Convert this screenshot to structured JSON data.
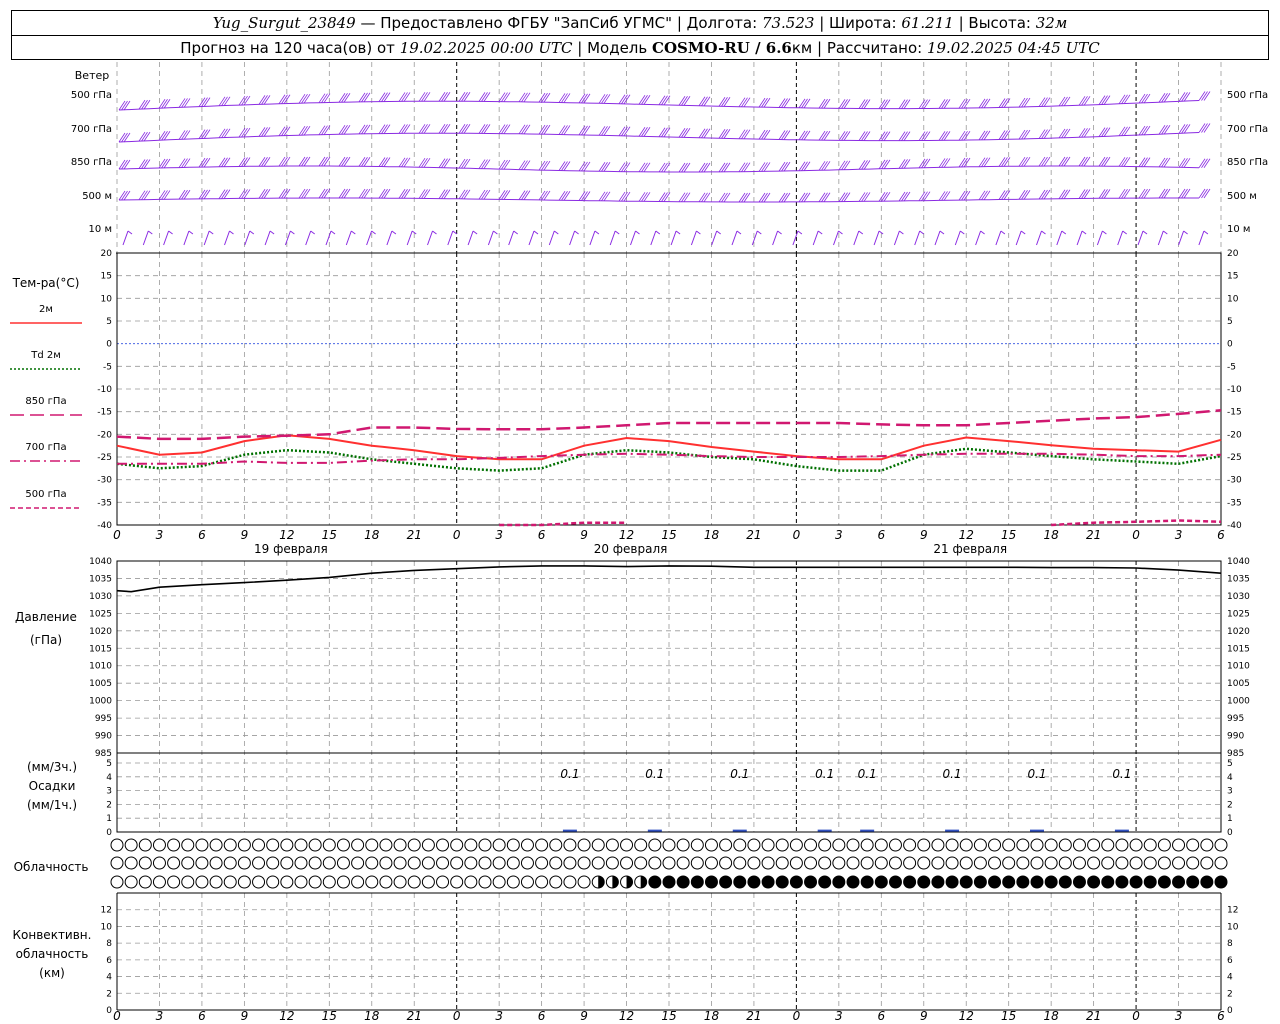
{
  "header": {
    "station": "Yug_Surgut_23849",
    "provider": "— Предоставлено ФГБУ \"ЗапСиб УГМС\"",
    "lon_label": "Долгота:",
    "lon": "73.523",
    "lat_label": "Широта:",
    "lat": "61.211",
    "alt_label": "Высота:",
    "alt": "32м",
    "forecast_label": "Прогноз на 120 часа(ов) от",
    "start": "19.02.2025 00:00 UTC",
    "model_label": "Модель",
    "model": "COSMO-RU / 6.6",
    "model_unit": "км",
    "calc_label": "Рассчитано:",
    "calc_time": "19.02.2025 04:45 UTC"
  },
  "wind_panel": {
    "title": "Ветер",
    "levels": [
      "500 гПа",
      "700 гПа",
      "850 гПа",
      "500 м",
      "10 м"
    ],
    "color": "#8a2be2"
  },
  "temp_panel": {
    "title": "Тем-ра(°C)",
    "legend": [
      {
        "label": "2м",
        "color": "#ff3030",
        "dash": "solid"
      },
      {
        "label": "Td 2м",
        "color": "#007000",
        "dash": "dot"
      },
      {
        "label": "850 гПа",
        "color": "#d01870",
        "dash": "longdash"
      },
      {
        "label": "700 гПа",
        "color": "#d01870",
        "dash": "dashdot"
      },
      {
        "label": "500 гПа",
        "color": "#d01870",
        "dash": "shortdash"
      }
    ],
    "yticks": [
      "20",
      "15",
      "10",
      "5",
      "0",
      "-5",
      "-10",
      "-15",
      "-20",
      "-25",
      "-30",
      "-35",
      "-40"
    ]
  },
  "time_axis": {
    "hour_labels": [
      "0",
      "3",
      "6",
      "9",
      "12",
      "15",
      "18",
      "21",
      "0",
      "3",
      "6",
      "9",
      "12",
      "15",
      "18",
      "21",
      "0",
      "3",
      "6",
      "9",
      "12",
      "15",
      "18",
      "21",
      "0",
      "3",
      "6"
    ],
    "day_labels": [
      "19 февраля",
      "20 февраля",
      "21 февраля"
    ]
  },
  "pressure_panel": {
    "title": "Давление",
    "unit": "(гПа)",
    "yticks": [
      "1040",
      "1035",
      "1030",
      "1025",
      "1020",
      "1015",
      "1010",
      "1005",
      "1000",
      "995",
      "990",
      "985"
    ]
  },
  "precip_panel": {
    "unit_top": "(мм/3ч.)",
    "title": "Осадки",
    "unit_bottom": "(мм/1ч.)",
    "yticks": [
      "5",
      "4",
      "3",
      "2",
      "1",
      "0"
    ],
    "labels": [
      "0.1",
      "0.1",
      "0.1",
      "0.1",
      "0.1",
      "0.1",
      "0.1",
      "0.1"
    ]
  },
  "cloud_panel": {
    "title": "Облачность"
  },
  "conv_panel": {
    "title_1": "Конвективн.",
    "title_2": "облачность",
    "unit": "(км)",
    "yticks": [
      "12",
      "10",
      "8",
      "6",
      "4",
      "2",
      "0"
    ]
  },
  "chart_data": [
    {
      "type": "line",
      "title": "Тем-ра(°C)",
      "x_hours": [
        0,
        3,
        6,
        9,
        12,
        15,
        18,
        21,
        24,
        27,
        30,
        33,
        36,
        39,
        42,
        45,
        48,
        51,
        54,
        57,
        60,
        63,
        66,
        69,
        72,
        75,
        78
      ],
      "ylim": [
        -40,
        20
      ],
      "series": [
        {
          "name": "2м",
          "values": [
            -22.5,
            -24.5,
            -24,
            -21.5,
            -20.2,
            -21,
            -22.5,
            -23.5,
            -24.8,
            -25.5,
            -25.5,
            -22.5,
            -20.8,
            -21.5,
            -22.8,
            -23.8,
            -24.8,
            -25.5,
            -25.5,
            -22.5,
            -20.7,
            -21.5,
            -22.4,
            -23.2,
            -23.5,
            -23.8,
            -21.2
          ]
        },
        {
          "name": "Td 2м",
          "values": [
            -26.5,
            -27.5,
            -27,
            -24.5,
            -23.5,
            -24,
            -25.5,
            -26.5,
            -27.5,
            -28,
            -27.5,
            -24.5,
            -23.5,
            -24,
            -25,
            -25.5,
            -27,
            -28,
            -28,
            -24.5,
            -23.2,
            -24,
            -24.8,
            -25.5,
            -26,
            -26.5,
            -24.8
          ]
        },
        {
          "name": "850 гПа",
          "values": [
            -20.5,
            -21,
            -21,
            -20.5,
            -20.3,
            -20,
            -18.5,
            -18.5,
            -18.8,
            -18.9,
            -18.9,
            -18.5,
            -18,
            -17.5,
            -17.5,
            -17.5,
            -17.5,
            -17.5,
            -17.8,
            -18,
            -18,
            -17.5,
            -17,
            -16.5,
            -16.2,
            -15.5,
            -14.7
          ]
        },
        {
          "name": "700 гПа",
          "values": [
            -26.5,
            -26.5,
            -26.5,
            -26,
            -26.3,
            -26.3,
            -25.8,
            -25.5,
            -25.5,
            -25.2,
            -24.8,
            -24.5,
            -24.3,
            -24.5,
            -24.8,
            -25,
            -25,
            -25,
            -24.8,
            -24.5,
            -24.3,
            -24.3,
            -24.3,
            -24.5,
            -24.8,
            -24.8,
            -24.5
          ]
        },
        {
          "name": "500 гПа",
          "values": [
            null,
            null,
            null,
            null,
            null,
            null,
            null,
            null,
            null,
            -40,
            -40,
            -39.5,
            -39.5,
            null,
            null,
            null,
            null,
            null,
            null,
            null,
            null,
            null,
            -40,
            -39.5,
            -39.3,
            -39,
            -39.3
          ]
        }
      ]
    },
    {
      "type": "line",
      "title": "Давление",
      "x_hours": [
        0,
        1,
        3,
        6,
        9,
        12,
        15,
        18,
        21,
        24,
        27,
        30,
        33,
        36,
        39,
        42,
        45,
        48,
        51,
        54,
        57,
        60,
        63,
        66,
        69,
        72,
        75,
        78
      ],
      "ylim": [
        985,
        1040
      ],
      "values": [
        1031.5,
        1031.2,
        1032.5,
        1033.2,
        1033.8,
        1034.5,
        1035.3,
        1036.5,
        1037.3,
        1037.8,
        1038.3,
        1038.6,
        1038.6,
        1038.4,
        1038.6,
        1038.5,
        1038.2,
        1038.2,
        1038.2,
        1038.2,
        1038.2,
        1038.2,
        1038.2,
        1038.1,
        1038.1,
        1038,
        1037.4,
        1036.5
      ]
    },
    {
      "type": "bar",
      "title": "Осадки",
      "x_hours": [
        32,
        38,
        44,
        50,
        53,
        59,
        65,
        71
      ],
      "values": [
        0.1,
        0.1,
        0.1,
        0.1,
        0.1,
        0.1,
        0.1,
        0.1
      ],
      "ylim": [
        0,
        5
      ]
    }
  ]
}
